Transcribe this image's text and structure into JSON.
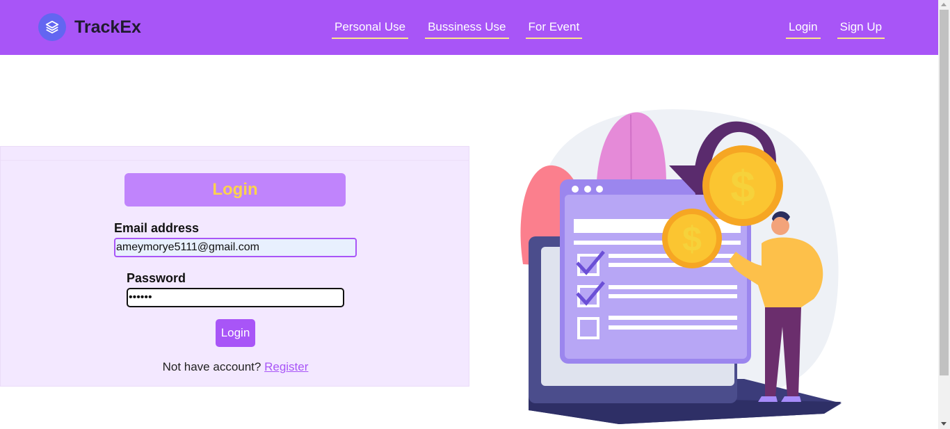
{
  "brand": {
    "name": "TrackEx",
    "logo_icon": "stack-layers-icon"
  },
  "nav": {
    "center": [
      {
        "label": "Personal Use"
      },
      {
        "label": "Bussiness Use"
      },
      {
        "label": "For Event"
      }
    ],
    "right": [
      {
        "label": "Login"
      },
      {
        "label": "Sign Up"
      }
    ]
  },
  "login_form": {
    "title": "Login",
    "email_label": "Email address",
    "email_value": "ameymorye5111@gmail.com",
    "password_label": "Password",
    "password_value": "123456",
    "submit_label": "Login",
    "no_account_text": "Not have account?",
    "register_link": "Register"
  },
  "illustration": {
    "icon": "finance-checklist-illustration"
  },
  "colors": {
    "header_bg": "#a855f7",
    "panel_bg": "#f3e8ff",
    "accent": "#a855f7",
    "title_text": "#fcd34d",
    "nav_underline": "#fde68a"
  }
}
